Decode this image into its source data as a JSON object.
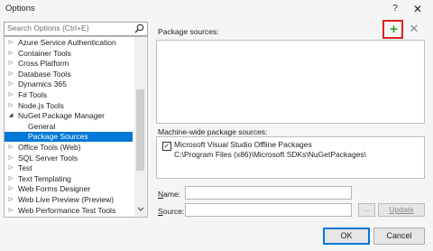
{
  "window": {
    "title": "Options",
    "help_label": "?",
    "close_label": "✕"
  },
  "search": {
    "placeholder": "Search Options (Ctrl+E)"
  },
  "tree": {
    "items": [
      {
        "label": "Azure Service Authentication",
        "arrow": "▷"
      },
      {
        "label": "Container Tools",
        "arrow": "▷"
      },
      {
        "label": "Cross Platform",
        "arrow": "▷"
      },
      {
        "label": "Database Tools",
        "arrow": "▷"
      },
      {
        "label": "Dynamics 365",
        "arrow": "▷"
      },
      {
        "label": "F# Tools",
        "arrow": "▷"
      },
      {
        "label": "Node.js Tools",
        "arrow": "▷"
      },
      {
        "label": "NuGet Package Manager",
        "arrow": "◢"
      },
      {
        "label": "General",
        "arrow": ""
      },
      {
        "label": "Package Sources",
        "arrow": ""
      },
      {
        "label": "Office Tools (Web)",
        "arrow": "▷"
      },
      {
        "label": "SQL Server Tools",
        "arrow": "▷"
      },
      {
        "label": "Test",
        "arrow": "▷"
      },
      {
        "label": "Text Templating",
        "arrow": "▷"
      },
      {
        "label": "Web Forms Designer",
        "arrow": "▷"
      },
      {
        "label": "Web Live Preview (Preview)",
        "arrow": "▷"
      },
      {
        "label": "Web Performance Test Tools",
        "arrow": "▷"
      }
    ]
  },
  "main": {
    "package_sources_label": "Package sources:",
    "add_label": "+",
    "remove_label": "✕",
    "machine_wide_label": "Machine-wide package sources:",
    "machine_wide_items": [
      {
        "checked": "✓",
        "name": "Microsoft Visual Studio Offline Packages",
        "path": "C:\\Program Files (x86)\\Microsoft SDKs\\NuGetPackages\\"
      }
    ],
    "name_label_accel": "N",
    "name_label_rest": "ame:",
    "source_label_accel": "S",
    "source_label_rest": "ource:",
    "name_value": "",
    "source_value": "",
    "browse_label": "...",
    "update_label": "Update"
  },
  "footer": {
    "ok_label": "OK",
    "cancel_label": "Cancel",
    "grip": "⋰"
  },
  "colors": {
    "selection": "#0078d7",
    "add_icon": "#2ea02e",
    "highlight_border": "#e02020"
  }
}
